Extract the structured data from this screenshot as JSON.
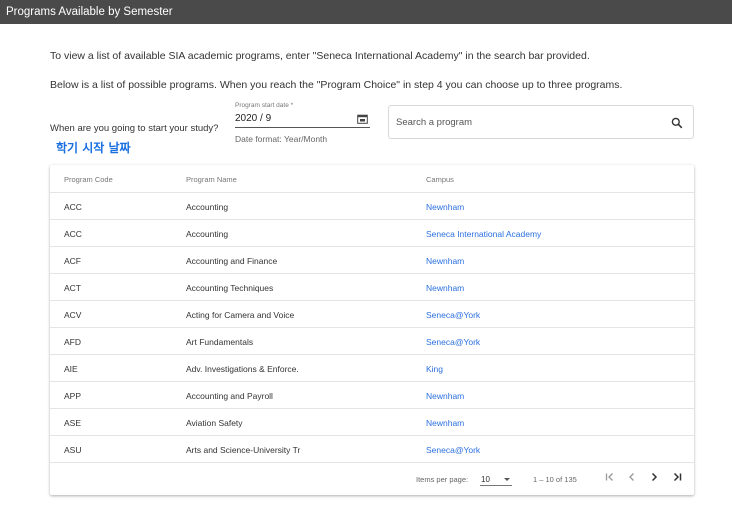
{
  "window": {
    "title": "Programs Available by Semester"
  },
  "intro": {
    "line1": "To view a list of available SIA academic programs, enter \"Seneca International Academy\" in the search bar provided.",
    "line2": "Below is a list of possible programs. When you reach the \"Program Choice\" in step 4 you can choose up to three programs."
  },
  "start_date": {
    "question": "When are you going to start your study?",
    "annotation": "학기 시작 날짜",
    "field_label": "Program start date *",
    "value": "2020 / 9",
    "hint": "Date format: Year/Month"
  },
  "search": {
    "placeholder": "Search a program",
    "value": ""
  },
  "table": {
    "headers": {
      "code": "Program Code",
      "name": "Program Name",
      "campus": "Campus"
    },
    "rows": [
      {
        "code": "ACC",
        "name": "Accounting",
        "campus": "Newnham"
      },
      {
        "code": "ACC",
        "name": "Accounting",
        "campus": "Seneca International Academy"
      },
      {
        "code": "ACF",
        "name": "Accounting and Finance",
        "campus": "Newnham"
      },
      {
        "code": "ACT",
        "name": "Accounting Techniques",
        "campus": "Newnham"
      },
      {
        "code": "ACV",
        "name": "Acting for Camera and Voice",
        "campus": "Seneca@York"
      },
      {
        "code": "AFD",
        "name": "Art Fundamentals",
        "campus": "Seneca@York"
      },
      {
        "code": "AIE",
        "name": "Adv. Investigations & Enforce.",
        "campus": "King"
      },
      {
        "code": "APP",
        "name": "Accounting and Payroll",
        "campus": "Newnham"
      },
      {
        "code": "ASE",
        "name": "Aviation Safety",
        "campus": "Newnham"
      },
      {
        "code": "ASU",
        "name": "Arts and Science-University Tr",
        "campus": "Seneca@York"
      }
    ]
  },
  "paginator": {
    "items_per_page_label": "Items per page:",
    "items_per_page": "10",
    "range": "1 – 10 of 135"
  },
  "colors": {
    "titlebar": "#4a4a4a",
    "link": "#2a6fe0",
    "annotation": "#1a6fe0"
  }
}
